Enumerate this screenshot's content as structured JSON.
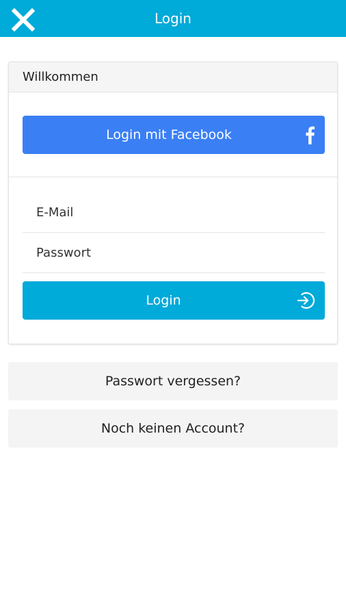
{
  "header": {
    "title": "Login",
    "close_icon": "close-icon",
    "background_color": "#00aad9"
  },
  "card": {
    "title": "Willkommen",
    "facebook_button": {
      "label": "Login mit Facebook",
      "icon": "facebook-icon",
      "color": "#3b7ff5"
    },
    "email_field": {
      "placeholder": "E-Mail",
      "value": ""
    },
    "password_field": {
      "placeholder": "Passwort",
      "value": ""
    },
    "login_button": {
      "label": "Login",
      "icon": "login-arrow-icon",
      "color": "#00aad9"
    }
  },
  "links": {
    "forgot_password": "Passwort vergessen?",
    "no_account": "Noch keinen Account?"
  }
}
